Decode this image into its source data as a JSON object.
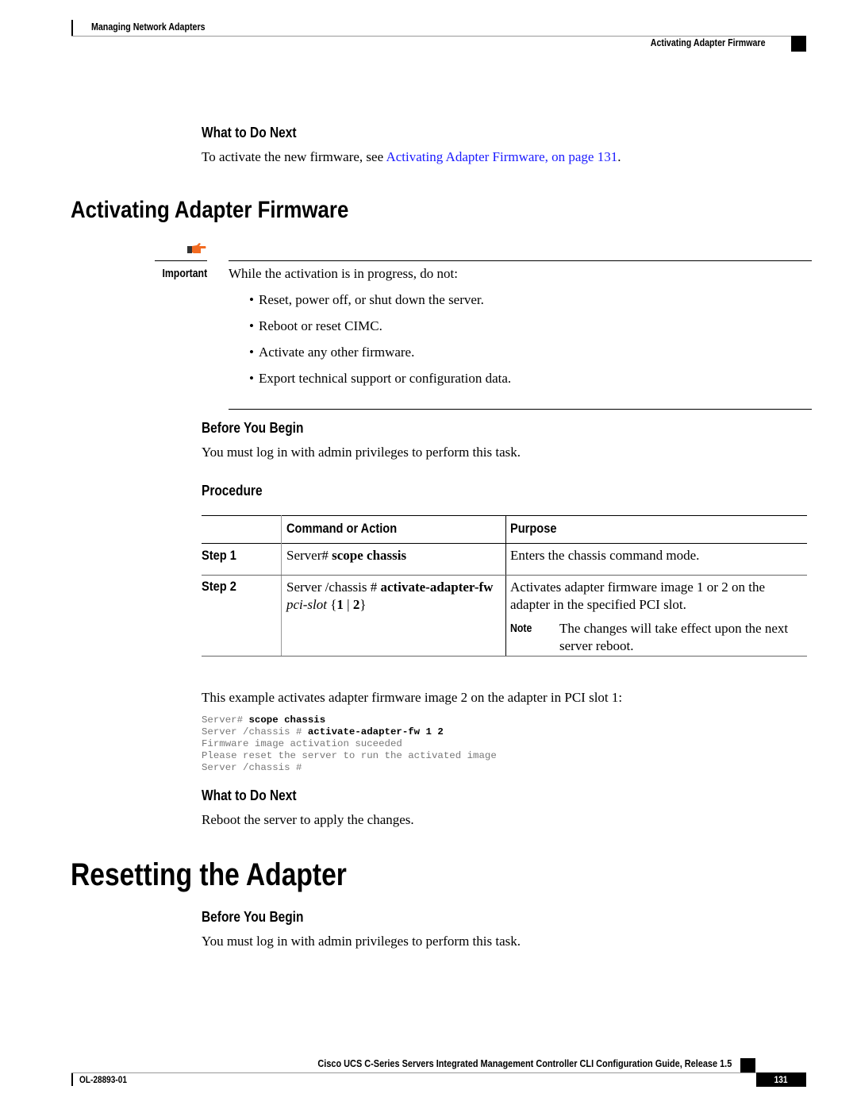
{
  "header": {
    "chapter": "Managing Network Adapters",
    "section": "Activating Adapter Firmware"
  },
  "prev_section": {
    "what_next_heading": "What to Do Next",
    "what_next_text": "To activate the new firmware, see ",
    "what_next_link": "Activating Adapter Firmware,  on page 131",
    "what_next_end": "."
  },
  "activating": {
    "title": "Activating Adapter Firmware",
    "important": {
      "icon": "pointing-hand-icon",
      "label": "Important",
      "intro": "While the activation is in progress, do not:",
      "bullets": [
        "Reset, power off, or shut down the server.",
        "Reboot or reset CIMC.",
        "Activate any other firmware.",
        "Export technical support or configuration data."
      ]
    },
    "before_heading": "Before You Begin",
    "before_text": "You must log in with admin privileges to perform this task.",
    "procedure_heading": "Procedure",
    "table": {
      "headers": [
        "",
        "Command or Action",
        "Purpose"
      ],
      "rows": [
        {
          "step": "Step 1",
          "cmd_prefix": "Server# ",
          "cmd_bold": "scope chassis",
          "purpose": "Enters the chassis command mode."
        },
        {
          "step": "Step 2",
          "cmd_prefix": "Server /chassis # ",
          "cmd_bold": "activate-adapter-fw",
          "cmd_italic": "pci-slot",
          "cmd_open": " {",
          "cmd_opt1": "1",
          "cmd_sep": " | ",
          "cmd_opt2": "2",
          "cmd_close": "}",
          "purpose": "Activates adapter firmware image 1 or 2 on the adapter in the specified PCI slot.",
          "note_label": "Note",
          "note_text": "The changes will take effect upon the next server reboot."
        }
      ]
    },
    "example_intro": "This example activates adapter firmware image 2 on the adapter in PCI slot 1:",
    "example_code": [
      {
        "prompt": "Server# ",
        "cmd": "scope chassis"
      },
      {
        "prompt": "Server /chassis # ",
        "cmd": "activate-adapter-fw 1 2"
      },
      {
        "prompt": "Firmware image activation suceeded",
        "cmd": ""
      },
      {
        "prompt": "Please reset the server to run the activated image",
        "cmd": ""
      },
      {
        "prompt": "Server /chassis #",
        "cmd": ""
      }
    ],
    "what_next_heading": "What to Do Next",
    "what_next_text": "Reboot the server to apply the changes."
  },
  "resetting": {
    "title": "Resetting the Adapter",
    "before_heading": "Before You Begin",
    "before_text": "You must log in with admin privileges to perform this task."
  },
  "footer": {
    "guide_title": "Cisco UCS C-Series Servers Integrated Management Controller CLI Configuration Guide, Release 1.5",
    "doc_number": "OL-28893-01",
    "page_number": "131"
  },
  "colors": {
    "link": "#1a1aff",
    "icon_orange": "#f26b21",
    "code_gray": "#777777"
  }
}
